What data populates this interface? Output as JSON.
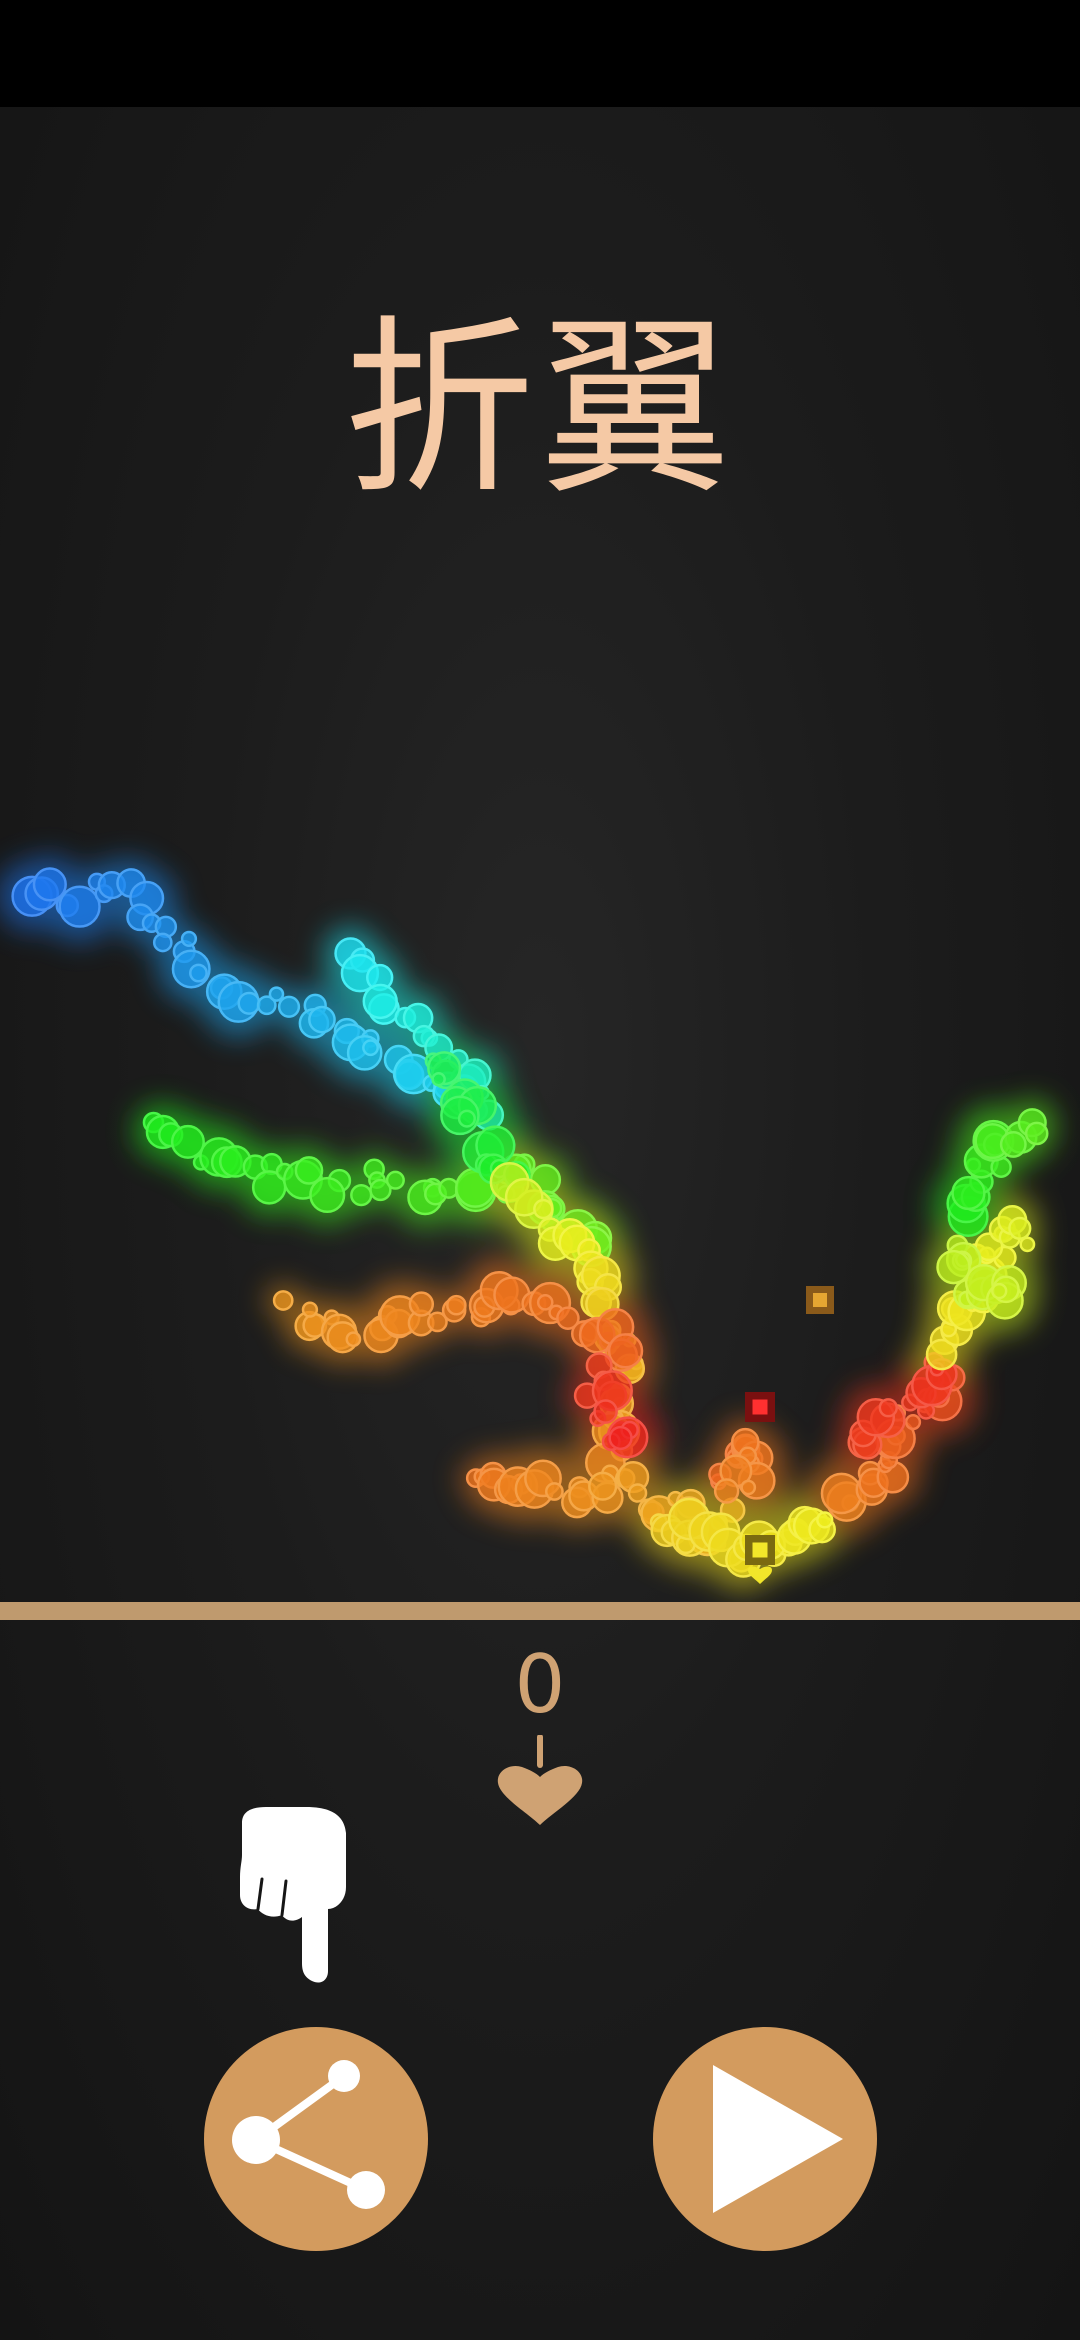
{
  "title": "折翼",
  "score": "0",
  "colors": {
    "title": "#f5c9a5",
    "accent": "#d39b5e",
    "ground": "#bf9a6e",
    "background": "#1c1c1c"
  },
  "icons": {
    "score": "leaf-icon",
    "hint": "pointing-hand-icon",
    "share": "share-icon",
    "play": "play-icon"
  },
  "buttons": {
    "share": "share-button",
    "play": "play-button"
  }
}
